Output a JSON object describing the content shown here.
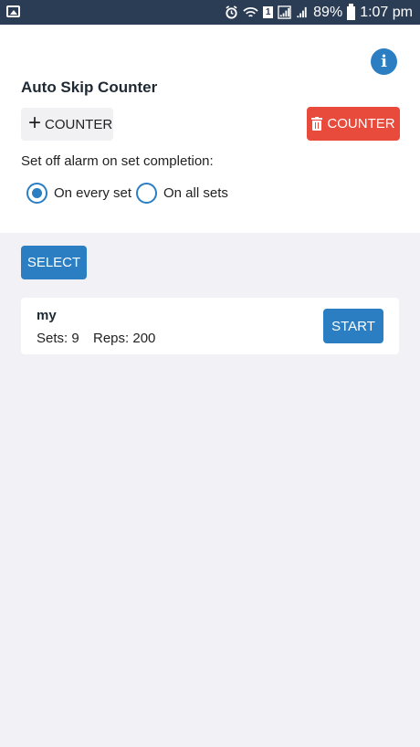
{
  "status_bar": {
    "left_icon": "image-icon",
    "sim_label": "1",
    "battery": "89%",
    "time": "1:07 pm"
  },
  "header": {
    "info_glyph": "i",
    "title": "Auto Skip Counter"
  },
  "actions": {
    "add_label": "COUNTER",
    "delete_label": "COUNTER"
  },
  "alarm": {
    "label": "Set off alarm on set completion:",
    "options": [
      {
        "label": "On every set",
        "selected": true
      },
      {
        "label": "On all sets",
        "selected": false
      }
    ]
  },
  "select_label": "SELECT",
  "counters": [
    {
      "name": "my",
      "sets": "Sets: 9",
      "reps": "Reps: 200",
      "start_label": "START"
    }
  ],
  "colors": {
    "accent": "#2b7ec2",
    "danger": "#e84a3c",
    "status_bar": "#2b3d55",
    "background": "#f2f1f6"
  }
}
